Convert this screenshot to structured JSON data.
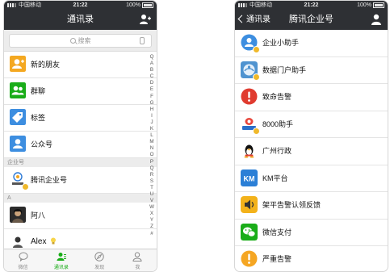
{
  "left_phone": {
    "status": {
      "carrier": "中国移动",
      "time": "21:22",
      "battery": "100%"
    },
    "title": "通讯录",
    "search_placeholder": "搜索",
    "top_rows": [
      {
        "label": "新的朋友",
        "icon": "add-friend-icon",
        "color": "#f4a821"
      },
      {
        "label": "群聊",
        "icon": "group-chat-icon",
        "color": "#1aad19"
      },
      {
        "label": "标签",
        "icon": "tag-icon",
        "color": "#3d8ee0"
      },
      {
        "label": "公众号",
        "icon": "official-account-icon",
        "color": "#3d8ee0"
      }
    ],
    "section_enterprise": "企业号",
    "enterprise_row": {
      "label": "腾讯企业号",
      "icon": "tencent-enterprise-icon"
    },
    "section_a": "A",
    "contact_rows": [
      {
        "label": "阿八",
        "icon": "avatar-aba"
      },
      {
        "label": "Alex",
        "icon": "avatar-alex"
      }
    ],
    "index_letters": [
      "Q",
      "A",
      "B",
      "C",
      "D",
      "E",
      "F",
      "G",
      "H",
      "I",
      "J",
      "K",
      "L",
      "M",
      "N",
      "O",
      "P",
      "Q",
      "R",
      "S",
      "T",
      "U",
      "V",
      "W",
      "X",
      "Y",
      "Z",
      "#"
    ],
    "tabs": [
      {
        "label": "微信",
        "icon": "chat-bubble-icon",
        "active": false
      },
      {
        "label": "通讯录",
        "icon": "contacts-icon",
        "active": true
      },
      {
        "label": "发现",
        "icon": "compass-icon",
        "active": false
      },
      {
        "label": "我",
        "icon": "profile-icon",
        "active": false
      }
    ]
  },
  "right_phone": {
    "status": {
      "carrier": "中国移动",
      "time": "21:22",
      "battery": "100%"
    },
    "back_label": "通讯录",
    "title": "腾讯企业号",
    "rows": [
      {
        "label": "企业小助手",
        "icon": "enterprise-assistant-icon",
        "color": "#3d8ee0"
      },
      {
        "label": "数据门户助手",
        "icon": "data-portal-icon",
        "color": "#4f93d0"
      },
      {
        "label": "致命告警",
        "icon": "fatal-alert-icon",
        "color": "#e03b2f"
      },
      {
        "label": "8000助手",
        "icon": "8000-assistant-icon",
        "color": "#2a6fc9"
      },
      {
        "label": "广州行政",
        "icon": "penguin-icon",
        "color": "#111111"
      },
      {
        "label": "KM平台",
        "icon": "km-platform-icon",
        "color": "#2b7fd6"
      },
      {
        "label": "架平告警认领反馈",
        "icon": "speaker-icon",
        "color": "#f3b21b"
      },
      {
        "label": "微信支付",
        "icon": "wechat-pay-icon",
        "color": "#1aad19"
      },
      {
        "label": "严重告警",
        "icon": "severe-alert-icon",
        "color": "#f5a623"
      }
    ]
  }
}
